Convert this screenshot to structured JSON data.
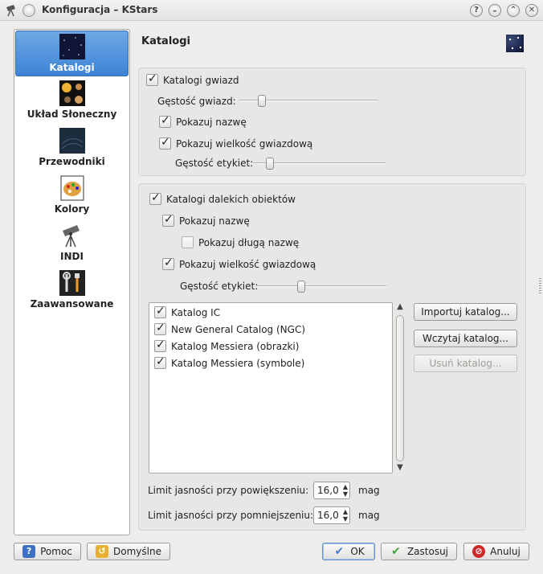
{
  "window": {
    "title": "Konfiguracja – KStars",
    "buttons": [
      "?",
      "⌄",
      "⌃",
      "✕"
    ]
  },
  "sidebar": {
    "items": [
      {
        "label": "Katalogi",
        "icon": "star-field-icon",
        "active": true
      },
      {
        "label": "Układ Słoneczny",
        "icon": "solar-system-icon",
        "active": false
      },
      {
        "label": "Przewodniki",
        "icon": "guides-icon",
        "active": false
      },
      {
        "label": "Kolory",
        "icon": "color-palette-icon",
        "active": false
      },
      {
        "label": "INDI",
        "icon": "telescope-icon",
        "active": false
      },
      {
        "label": "Zaawansowane",
        "icon": "tools-icon",
        "active": false
      }
    ]
  },
  "page": {
    "title": "Katalogi"
  },
  "stars": {
    "enabled_label": "Katalogi gwiazd",
    "enabled": true,
    "density_label": "Gęstość gwiazd:",
    "density_value": 0.18,
    "show_name_label": "Pokazuj nazwę",
    "show_name": true,
    "show_mag_label": "Pokazuj wielkość gwiazdową",
    "show_mag": true,
    "label_density_label": "Gęstość etykiet:",
    "label_density_value": 0.1
  },
  "deep_sky": {
    "enabled_label": "Katalogi dalekich obiektów",
    "enabled": true,
    "show_name_label": "Pokazuj nazwę",
    "show_name": true,
    "show_long_name_label": "Pokazuj długą nazwę",
    "show_long_name": false,
    "show_mag_label": "Pokazuj wielkość gwiazdową",
    "show_mag": true,
    "label_density_label": "Gęstość etykiet:",
    "label_density_value": 0.33,
    "catalogs": [
      {
        "label": "Katalog IC",
        "checked": true
      },
      {
        "label": "New General Catalog (NGC)",
        "checked": true
      },
      {
        "label": "Katalog Messiera (obrazki)",
        "checked": true
      },
      {
        "label": "Katalog Messiera (symbole)",
        "checked": true
      }
    ],
    "buttons": {
      "import": "Importuj katalog...",
      "load": "Wczytaj katalog...",
      "remove": "Usuń katalog..."
    },
    "zoom_in_limit_label": "Limit jasności przy powiększeniu:",
    "zoom_in_limit": "16,0",
    "zoom_out_limit_label": "Limit jasności przy pomniejszeniu:",
    "zoom_out_limit": "16,0",
    "unit": "mag"
  },
  "footer": {
    "help": "Pomoc",
    "defaults": "Domyślne",
    "ok": "OK",
    "apply": "Zastosuj",
    "cancel": "Anuluj"
  },
  "colors": {
    "accent": "#3d83d6",
    "ok_icon": "#4a7fd1",
    "apply_icon": "#3fa63f",
    "cancel_icon": "#d02828"
  }
}
